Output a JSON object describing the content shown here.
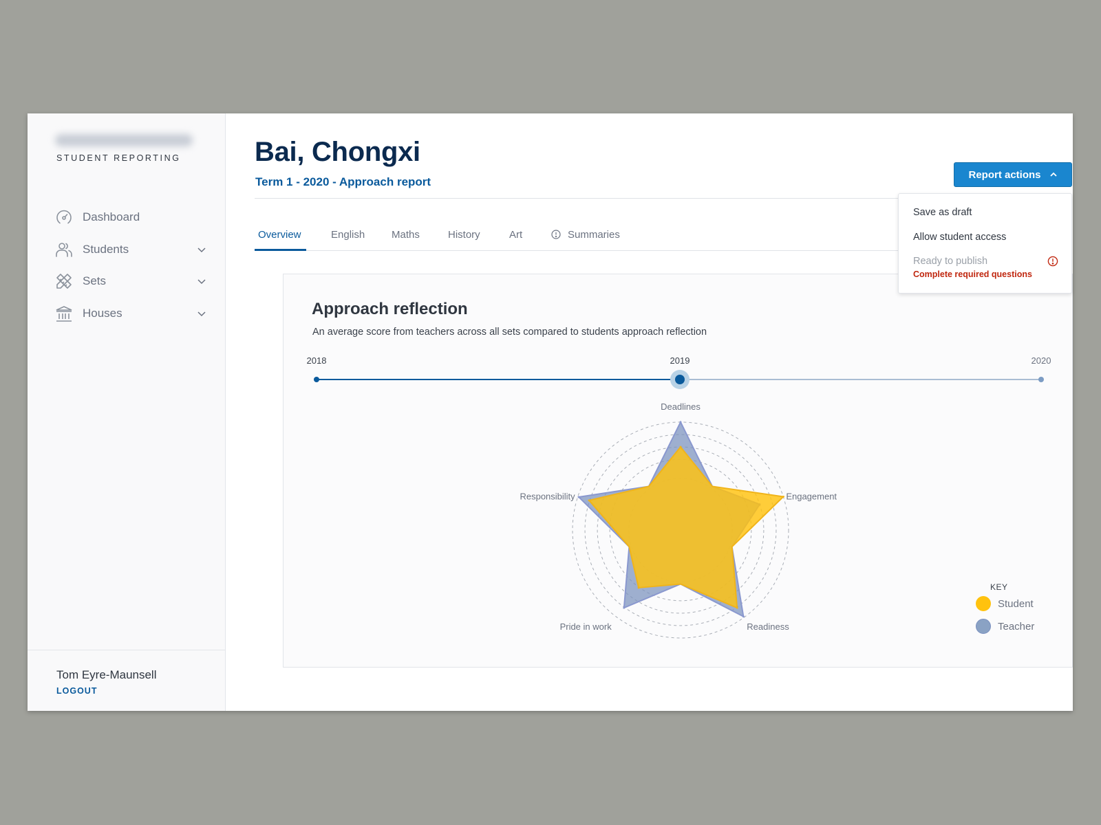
{
  "sidebar": {
    "logo_text": "Blurred school name",
    "subtitle": "STUDENT REPORTING",
    "nav": [
      {
        "label": "Dashboard",
        "icon": "dashboard-gauge-icon",
        "expandable": false
      },
      {
        "label": "Students",
        "icon": "users-icon",
        "expandable": true
      },
      {
        "label": "Sets",
        "icon": "pencil-ruler-icon",
        "expandable": true
      },
      {
        "label": "Houses",
        "icon": "institution-icon",
        "expandable": true
      }
    ],
    "user_name": "Tom Eyre-Maunsell",
    "logout_label": "LOGOUT"
  },
  "header": {
    "title": "Bai, Chongxi",
    "subtitle": "Term 1 - 2020 - Approach report",
    "report_actions_label": "Report actions",
    "report_actions_open": true
  },
  "dropdown": {
    "items": [
      {
        "label": "Save as draft",
        "enabled": true
      },
      {
        "label": "Allow student access",
        "enabled": true
      },
      {
        "label": "Ready to publish",
        "enabled": false
      }
    ],
    "warning": "Complete required questions",
    "warning_color": "#c0270f"
  },
  "tabs": [
    {
      "label": "Overview",
      "active": true,
      "icon": null
    },
    {
      "label": "English",
      "active": false,
      "icon": null
    },
    {
      "label": "Maths",
      "active": false,
      "icon": null
    },
    {
      "label": "History",
      "active": false,
      "icon": null
    },
    {
      "label": "Art",
      "active": false,
      "icon": null
    },
    {
      "label": "Summaries",
      "active": false,
      "icon": "alert-circle-icon"
    }
  ],
  "panel": {
    "title": "Approach reflection",
    "description": "An average score from teachers across all sets compared to students approach reflection",
    "timeline": {
      "years": [
        "2018",
        "2019",
        "2020"
      ],
      "selected": "2019",
      "selected_index": 1
    },
    "legend": {
      "title": "KEY",
      "items": [
        {
          "label": "Student",
          "color": "#ffc20e"
        },
        {
          "label": "Teacher",
          "color": "#8aa2c4"
        }
      ]
    }
  },
  "colors": {
    "brand": "#0a5a9c",
    "button": "#1a86cf",
    "title": "#0b2a4f"
  },
  "chart_data": {
    "type": "radar",
    "title": "Approach reflection",
    "axes": [
      "Deadlines",
      "Engagement",
      "Readiness",
      "Pride in work",
      "Responsibility"
    ],
    "range": [
      0,
      10
    ],
    "rings": 5,
    "inner_vertex_value": 5,
    "series": [
      {
        "name": "Teacher",
        "color": "#8aa2c4",
        "values": [
          10,
          7.7,
          9.9,
          8.9,
          9.9
        ]
      },
      {
        "name": "Student",
        "color": "#ffc20e",
        "values": [
          7.7,
          10,
          8.9,
          6.6,
          8.9
        ]
      }
    ],
    "legend_position": "bottom-right"
  }
}
